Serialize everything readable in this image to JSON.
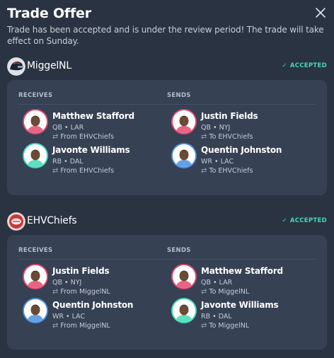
{
  "title": "Trade Offer",
  "subtitle": "Trade has been accepted and is under the review period! The trade will take effect on Sunday.",
  "columns": {
    "receives": "RECEIVES",
    "sends": "SENDS"
  },
  "colors": {
    "accent": "#41d9b5",
    "background": "#2a3341",
    "card": "#364154"
  },
  "teams": [
    {
      "name": "MiggelNL",
      "status": "ACCEPTED",
      "receives": [
        {
          "name": "Matthew Stafford",
          "meta": "QB • LAR",
          "from": "From EHVChiefs",
          "ring": "#e3496e"
        },
        {
          "name": "Javonte Williams",
          "meta": "RB • DAL",
          "from": "From EHVChiefs",
          "ring": "#41d9b5"
        }
      ],
      "sends": [
        {
          "name": "Justin Fields",
          "meta": "QB • NYJ",
          "from": "To EHVChiefs",
          "ring": "#e3496e"
        },
        {
          "name": "Quentin Johnston",
          "meta": "WR • LAC",
          "from": "To EHVChiefs",
          "ring": "#4a8fe0"
        }
      ]
    },
    {
      "name": "EHVChiefs",
      "status": "ACCEPTED",
      "receives": [
        {
          "name": "Justin Fields",
          "meta": "QB • NYJ",
          "from": "From MiggelNL",
          "ring": "#e3496e"
        },
        {
          "name": "Quentin Johnston",
          "meta": "WR • LAC",
          "from": "From MiggelNL",
          "ring": "#4a8fe0"
        }
      ],
      "sends": [
        {
          "name": "Matthew Stafford",
          "meta": "QB • LAR",
          "from": "To MiggelNL",
          "ring": "#e3496e"
        },
        {
          "name": "Javonte Williams",
          "meta": "RB • DAL",
          "from": "To MiggelNL",
          "ring": "#41d9b5"
        }
      ]
    }
  ]
}
